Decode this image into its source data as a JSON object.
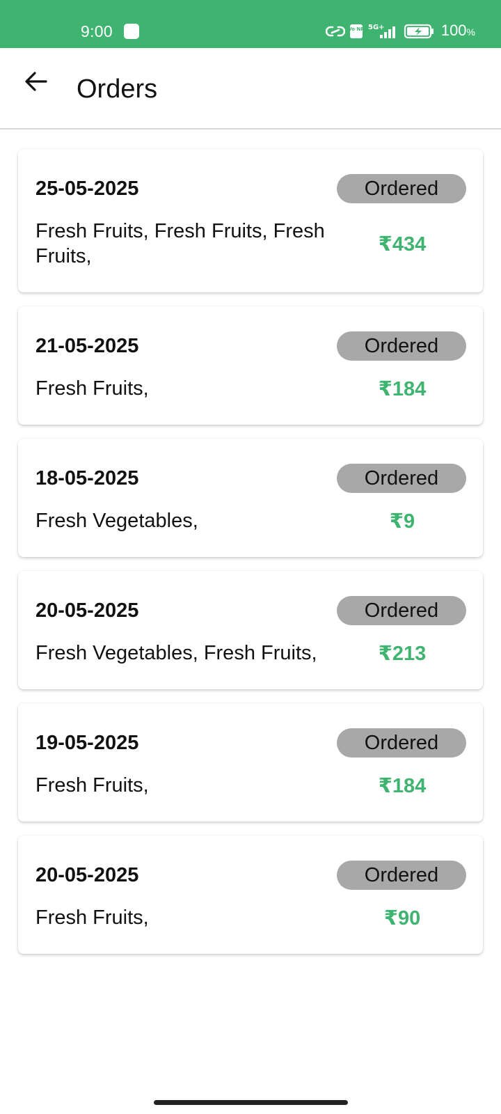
{
  "status_bar": {
    "time": "9:00",
    "battery": "100",
    "battery_unit": "%",
    "network_label": "5G+",
    "volte_label": "Vo NR",
    "background_color": "#3fb470"
  },
  "app_bar": {
    "back_icon": "arrow-left-icon",
    "title": "Orders"
  },
  "orders": [
    {
      "date": "25-05-2025",
      "status": "Ordered",
      "items": "Fresh Fruits, Fresh Fruits, Fresh Fruits,",
      "total": "₹434"
    },
    {
      "date": "21-05-2025",
      "status": "Ordered",
      "items": "Fresh Fruits,",
      "total": "₹184"
    },
    {
      "date": "18-05-2025",
      "status": "Ordered",
      "items": "Fresh Vegetables,",
      "total": "₹9"
    },
    {
      "date": "20-05-2025",
      "status": "Ordered",
      "items": "Fresh Vegetables, Fresh Fruits,",
      "total": "₹213"
    },
    {
      "date": "19-05-2025",
      "status": "Ordered",
      "items": "Fresh Fruits,",
      "total": "₹184"
    },
    {
      "date": "20-05-2025",
      "status": "Ordered",
      "items": "Fresh Fruits,",
      "total": "₹90"
    }
  ],
  "colors": {
    "accent": "#3fb470",
    "badge": "#a8a8a8"
  }
}
